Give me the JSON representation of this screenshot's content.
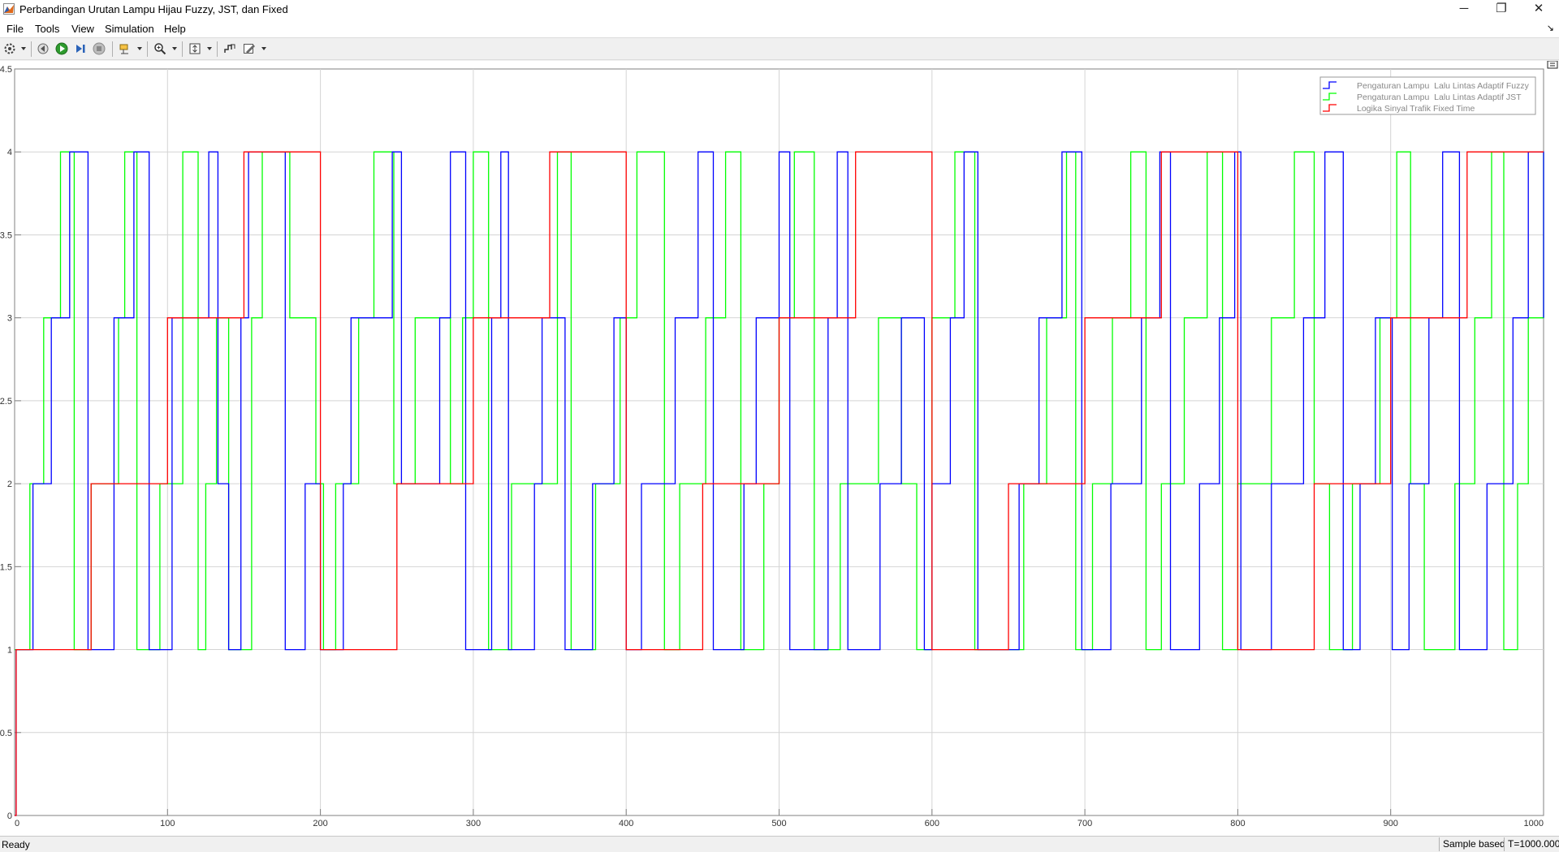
{
  "window": {
    "title": "Perbandingan Urutan Lampu Hijau Fuzzy, JST, dan Fixed",
    "app_icon": "matlab-icon",
    "controls": [
      "minimize-icon",
      "restore-icon",
      "close-icon"
    ],
    "controls_glyphs": {
      "minimize": "─",
      "restore": "❐",
      "close": "✕"
    }
  },
  "menu": {
    "items": [
      "File",
      "Tools",
      "View",
      "Simulation",
      "Help"
    ],
    "undock": "↘"
  },
  "toolbar": {
    "icons": [
      "configuration-properties-icon",
      "step-back-icon",
      "run-icon",
      "step-forward-icon",
      "stop-icon",
      "highlight-simulink-block-icon",
      "zoom-icon",
      "fit-to-view-icon",
      "triggers-icon",
      "style-icon"
    ]
  },
  "status": {
    "left": "Ready",
    "mode": "Sample based",
    "time": "T=1000.000"
  },
  "chart_data": {
    "type": "line",
    "step": true,
    "xlim": [
      0,
      1000
    ],
    "ylim": [
      0,
      4.5
    ],
    "x_ticks": [
      "0",
      "100",
      "200",
      "300",
      "400",
      "500",
      "600",
      "700",
      "800",
      "900",
      "1000"
    ],
    "y_ticks": [
      "0",
      "0.5",
      "1",
      "1.5",
      "2",
      "2.5",
      "3",
      "3.5",
      "4",
      "4.5"
    ],
    "grid": true,
    "legend_position": "top-right",
    "series": [
      {
        "name": "Pengaturan Lampu  Lalu Lintas Adaptif Fuzzy",
        "color": "#0000ff",
        "points": [
          [
            0,
            0
          ],
          [
            1,
            1
          ],
          [
            12,
            2
          ],
          [
            24,
            3
          ],
          [
            36,
            4
          ],
          [
            48,
            1
          ],
          [
            65,
            3
          ],
          [
            78,
            4
          ],
          [
            88,
            1
          ],
          [
            103,
            3
          ],
          [
            127,
            4
          ],
          [
            133,
            2
          ],
          [
            140,
            1
          ],
          [
            148,
            3
          ],
          [
            153,
            4
          ],
          [
            177,
            1
          ],
          [
            190,
            2
          ],
          [
            200,
            1
          ],
          [
            215,
            2
          ],
          [
            220,
            3
          ],
          [
            247,
            4
          ],
          [
            253,
            2
          ],
          [
            278,
            3
          ],
          [
            285,
            4
          ],
          [
            295,
            1
          ],
          [
            312,
            3
          ],
          [
            318,
            4
          ],
          [
            323,
            1
          ],
          [
            340,
            2
          ],
          [
            345,
            3
          ],
          [
            360,
            1
          ],
          [
            378,
            2
          ],
          [
            392,
            3
          ],
          [
            400,
            1
          ],
          [
            410,
            2
          ],
          [
            432,
            3
          ],
          [
            447,
            4
          ],
          [
            457,
            1
          ],
          [
            477,
            2
          ],
          [
            485,
            3
          ],
          [
            500,
            4
          ],
          [
            507,
            1
          ],
          [
            532,
            3
          ],
          [
            538,
            4
          ],
          [
            545,
            1
          ],
          [
            566,
            2
          ],
          [
            580,
            3
          ],
          [
            595,
            1
          ],
          [
            600,
            2
          ],
          [
            612,
            3
          ],
          [
            621,
            4
          ],
          [
            630,
            1
          ],
          [
            657,
            2
          ],
          [
            670,
            3
          ],
          [
            685,
            4
          ],
          [
            698,
            1
          ],
          [
            717,
            2
          ],
          [
            737,
            3
          ],
          [
            749,
            4
          ],
          [
            756,
            1
          ],
          [
            775,
            2
          ],
          [
            788,
            3
          ],
          [
            798,
            4
          ],
          [
            802,
            1
          ],
          [
            822,
            2
          ],
          [
            843,
            3
          ],
          [
            857,
            4
          ],
          [
            869,
            1
          ],
          [
            880,
            2
          ],
          [
            890,
            3
          ],
          [
            901,
            1
          ],
          [
            912,
            2
          ],
          [
            925,
            3
          ],
          [
            934,
            4
          ],
          [
            945,
            1
          ],
          [
            963,
            2
          ],
          [
            980,
            3
          ],
          [
            990,
            4
          ],
          [
            1000,
            3
          ]
        ]
      },
      {
        "name": "Pengaturan Lampu  Lalu Lintas Adaptif JST",
        "color": "#00ff00",
        "points": [
          [
            0,
            1
          ],
          [
            10,
            2
          ],
          [
            19,
            3
          ],
          [
            30,
            4
          ],
          [
            39,
            1
          ],
          [
            50,
            2
          ],
          [
            68,
            3
          ],
          [
            72,
            4
          ],
          [
            80,
            1
          ],
          [
            95,
            2
          ],
          [
            110,
            4
          ],
          [
            120,
            1
          ],
          [
            125,
            2
          ],
          [
            132,
            3
          ],
          [
            140,
            1
          ],
          [
            155,
            3
          ],
          [
            162,
            4
          ],
          [
            180,
            3
          ],
          [
            197,
            2
          ],
          [
            202,
            1
          ],
          [
            210,
            2
          ],
          [
            225,
            3
          ],
          [
            235,
            4
          ],
          [
            248,
            2
          ],
          [
            262,
            3
          ],
          [
            285,
            2
          ],
          [
            293,
            3
          ],
          [
            300,
            4
          ],
          [
            310,
            1
          ],
          [
            325,
            2
          ],
          [
            355,
            4
          ],
          [
            364,
            1
          ],
          [
            380,
            2
          ],
          [
            396,
            3
          ],
          [
            407,
            4
          ],
          [
            425,
            1
          ],
          [
            435,
            2
          ],
          [
            452,
            3
          ],
          [
            465,
            4
          ],
          [
            475,
            1
          ],
          [
            490,
            2
          ],
          [
            500,
            3
          ],
          [
            510,
            4
          ],
          [
            523,
            1
          ],
          [
            540,
            2
          ],
          [
            565,
            3
          ],
          [
            580,
            2
          ],
          [
            590,
            1
          ],
          [
            600,
            3
          ],
          [
            615,
            4
          ],
          [
            628,
            1
          ],
          [
            660,
            2
          ],
          [
            675,
            3
          ],
          [
            688,
            4
          ],
          [
            694,
            1
          ],
          [
            705,
            2
          ],
          [
            718,
            3
          ],
          [
            730,
            4
          ],
          [
            740,
            1
          ],
          [
            750,
            2
          ],
          [
            765,
            3
          ],
          [
            780,
            4
          ],
          [
            790,
            1
          ],
          [
            800,
            2
          ],
          [
            822,
            3
          ],
          [
            837,
            4
          ],
          [
            850,
            2
          ],
          [
            860,
            1
          ],
          [
            875,
            2
          ],
          [
            893,
            3
          ],
          [
            904,
            4
          ],
          [
            913,
            2
          ],
          [
            922,
            1
          ],
          [
            942,
            2
          ],
          [
            955,
            3
          ],
          [
            966,
            4
          ],
          [
            974,
            1
          ],
          [
            983,
            2
          ],
          [
            990,
            3
          ],
          [
            1000,
            4
          ]
        ]
      },
      {
        "name": "Logika Sinyal Trafik Fixed Time",
        "color": "#ff0000",
        "points": [
          [
            0,
            0
          ],
          [
            1,
            1
          ],
          [
            50,
            2
          ],
          [
            100,
            3
          ],
          [
            150,
            4
          ],
          [
            200,
            1
          ],
          [
            250,
            2
          ],
          [
            300,
            3
          ],
          [
            350,
            4
          ],
          [
            400,
            1
          ],
          [
            450,
            2
          ],
          [
            500,
            3
          ],
          [
            550,
            4
          ],
          [
            600,
            1
          ],
          [
            650,
            2
          ],
          [
            700,
            3
          ],
          [
            750,
            4
          ],
          [
            800,
            1
          ],
          [
            850,
            2
          ],
          [
            900,
            3
          ],
          [
            950,
            4
          ],
          [
            1000,
            4
          ]
        ]
      }
    ]
  }
}
